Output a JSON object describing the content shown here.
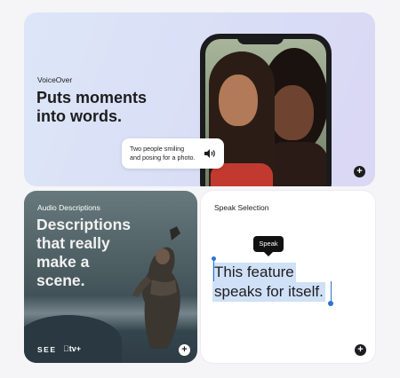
{
  "voiceover": {
    "eyebrow": "VoiceOver",
    "headline": "Puts moments into words.",
    "caption_line1": "Two people smiling",
    "caption_line2": "and posing for a photo."
  },
  "audio_descriptions": {
    "eyebrow": "Audio Descriptions",
    "headline": "Descriptions that really make a scene.",
    "show_title": "SEE",
    "service": "tv+"
  },
  "speak_selection": {
    "eyebrow": "Speak Selection",
    "tooltip": "Speak",
    "selected_line1": "This feature",
    "selected_line2": "speaks for itself."
  },
  "icons": {
    "expand": "plus-icon",
    "speaker": "speaker-icon"
  },
  "colors": {
    "selection_highlight": "#cfe0f7",
    "selection_handles": "#2b72d6"
  }
}
